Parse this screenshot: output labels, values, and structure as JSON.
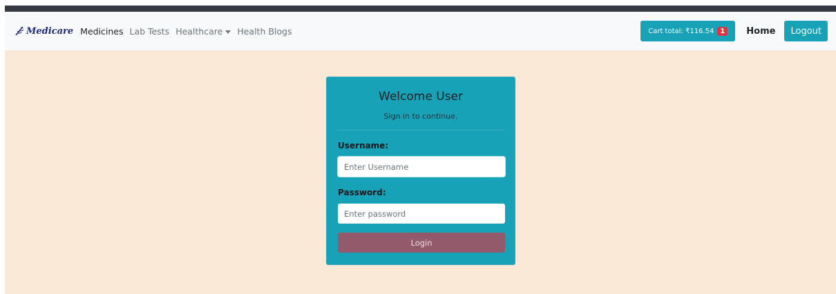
{
  "navbar": {
    "brand": {
      "logo_icon": "caduceus-logo-icon",
      "name": "Medicare"
    },
    "links": [
      {
        "label": "Medicines",
        "active": true
      },
      {
        "label": "Lab Tests",
        "active": false
      },
      {
        "label": "Healthcare",
        "active": false,
        "dropdown": true
      },
      {
        "label": "Health Blogs",
        "active": false
      }
    ],
    "cart": {
      "label": "Cart total: ₹116.54",
      "count": "1"
    },
    "home_label": "Home",
    "logout_label": "Logout"
  },
  "login_card": {
    "title": "Welcome User",
    "subtitle": "Sign in to continue.",
    "username": {
      "label": "Username:",
      "placeholder": "Enter Username",
      "value": ""
    },
    "password": {
      "label": "Password:",
      "placeholder": "Enter password",
      "value": ""
    },
    "submit_label": "Login"
  },
  "colors": {
    "accent": "#17a2b8",
    "background": "#fae9d6",
    "login_button": "#925a6a",
    "badge": "#dc3545"
  }
}
